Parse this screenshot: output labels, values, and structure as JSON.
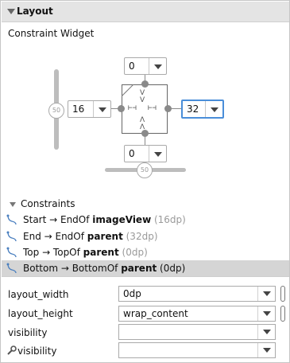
{
  "header": {
    "title": "Layout"
  },
  "widget": {
    "label": "Constraint Widget",
    "top_margin": "0",
    "bottom_margin": "0",
    "left_margin": "16",
    "right_margin": "32",
    "vertical_bias": "50",
    "horizontal_bias": "50"
  },
  "constraints": {
    "label": "Constraints",
    "items": [
      {
        "prefix": "Start → EndOf ",
        "target": "imageView",
        "margin": " (16dp)"
      },
      {
        "prefix": "End → EndOf ",
        "target": "parent",
        "margin": " (32dp)"
      },
      {
        "prefix": "Top → TopOf ",
        "target": "parent",
        "margin": " (0dp)"
      },
      {
        "prefix": "Bottom → BottomOf ",
        "target": "parent",
        "margin": " (0dp)"
      }
    ]
  },
  "properties": [
    {
      "label": "layout_width",
      "value": "0dp"
    },
    {
      "label": "layout_height",
      "value": "wrap_content"
    },
    {
      "label": "visibility",
      "value": ""
    },
    {
      "label": "visibility",
      "value": ""
    }
  ]
}
